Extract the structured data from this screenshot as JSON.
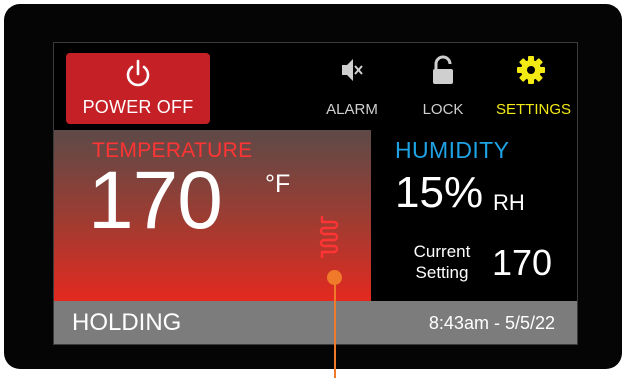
{
  "power": {
    "label": "POWER OFF",
    "icon": "power-icon",
    "color": "#c52026"
  },
  "toolbar": {
    "alarm": {
      "label": "ALARM",
      "icon": "speaker-muted-icon"
    },
    "lock": {
      "label": "LOCK",
      "icon": "unlock-icon"
    },
    "settings": {
      "label": "SETTINGS",
      "icon": "gear-icon",
      "color": "#f3ea14"
    }
  },
  "temperature": {
    "title": "TEMPERATURE",
    "value": "170",
    "unit": "°F",
    "icon": "heater-coil-icon",
    "title_color": "#ff3434"
  },
  "humidity": {
    "title": "HUMIDITY",
    "value": "15%",
    "unit": "RH",
    "title_color": "#1fa2e3"
  },
  "current_setting": {
    "label": "Current Setting",
    "value": "170"
  },
  "status": {
    "text": "HOLDING",
    "datetime": "8:43am - 5/5/22"
  },
  "callout": {
    "color": "#ef7b2a"
  }
}
